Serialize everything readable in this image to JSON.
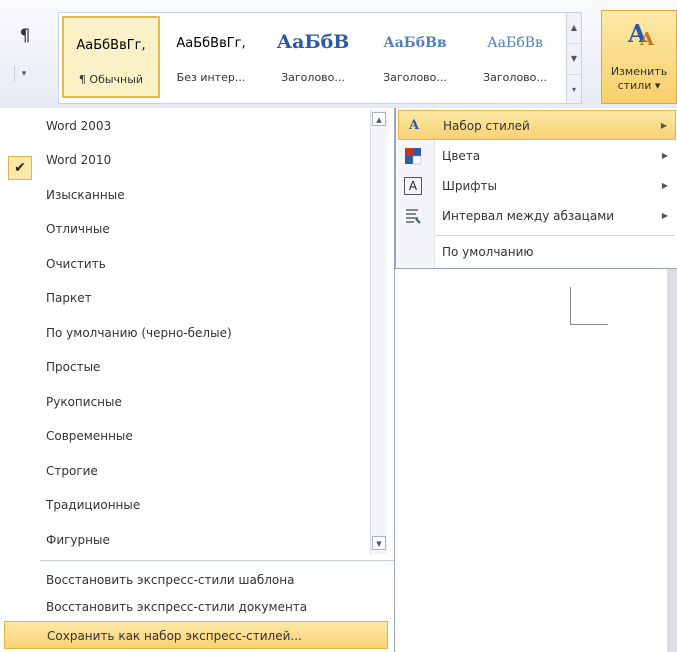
{
  "ribbon": {
    "paragraph_mark": "¶",
    "styles_gallery": [
      {
        "sample": "АаБбВвГг,",
        "name": "¶ Обычный",
        "selected": true,
        "sample_color": "#000000"
      },
      {
        "sample": "АаБбВвГг,",
        "name": "Без интер...",
        "selected": false,
        "sample_color": "#000000"
      },
      {
        "sample": "АаБбВ",
        "name": "Заголово...",
        "selected": false,
        "sample_color": "#2b5aa7"
      },
      {
        "sample": "АаБбВв",
        "name": "Заголово...",
        "selected": false,
        "sample_color": "#4f81bd"
      },
      {
        "sample": "АаБбВв",
        "name": "Заголово...",
        "selected": false,
        "sample_color": "#4f81bd"
      }
    ],
    "change_styles": {
      "line1": "Изменить",
      "line2": "стили ▾"
    }
  },
  "style_sets_menu": {
    "items": [
      {
        "label": "Word 2003",
        "checked": false
      },
      {
        "label": "Word 2010",
        "checked": true
      },
      {
        "label": "Изысканные",
        "checked": false
      },
      {
        "label": "Отличные",
        "checked": false
      },
      {
        "label": "Очистить",
        "checked": false
      },
      {
        "label": "Паркет",
        "checked": false
      },
      {
        "label": "По умолчанию (черно-белые)",
        "checked": false
      },
      {
        "label": "Простые",
        "checked": false
      },
      {
        "label": "Рукописные",
        "checked": false
      },
      {
        "label": "Современные",
        "checked": false
      },
      {
        "label": "Строгие",
        "checked": false
      },
      {
        "label": "Традиционные",
        "checked": false
      },
      {
        "label": "Фигурные",
        "checked": false
      }
    ],
    "actions": [
      {
        "label": "Восстановить экспресс-стили шаблона",
        "highlighted": false
      },
      {
        "label": "Восстановить экспресс-стили документа",
        "highlighted": false
      },
      {
        "label": "Сохранить как набор экспресс-стилей...",
        "highlighted": true
      }
    ]
  },
  "change_styles_submenu": {
    "items": [
      {
        "label": "Набор стилей",
        "icon": "style-set-icon",
        "has_arrow": true,
        "active": true
      },
      {
        "label": "Цвета",
        "icon": "colors-icon",
        "has_arrow": true,
        "active": false
      },
      {
        "label": "Шрифты",
        "icon": "fonts-icon",
        "has_arrow": true,
        "active": false
      },
      {
        "label": "Интервал между абзацами",
        "icon": "paragraph-spacing-icon",
        "has_arrow": true,
        "active": false
      },
      {
        "label": "По умолчанию",
        "icon": "",
        "has_arrow": false,
        "active": false
      }
    ]
  },
  "colors": {
    "accent_highlight": "#f8d175",
    "heading_blue": "#2b5aa7"
  }
}
